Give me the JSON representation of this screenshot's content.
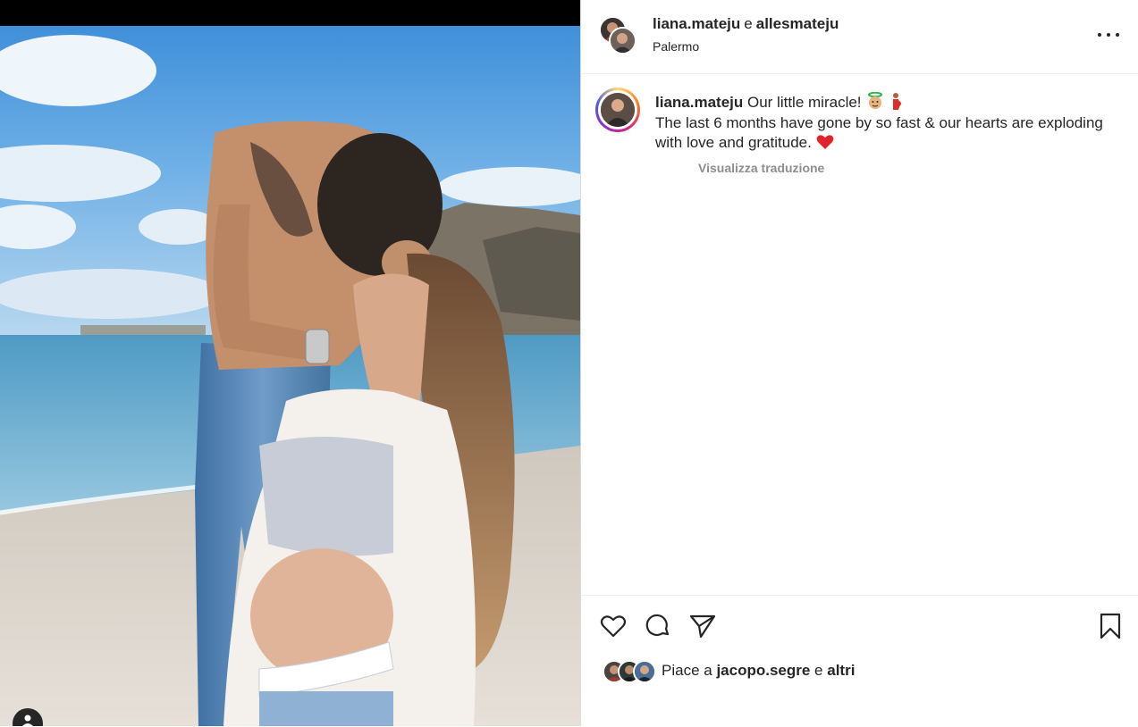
{
  "post": {
    "authors": [
      "liana.mateju",
      "allesmateju"
    ],
    "authors_conjunction": "e",
    "location": "Palermo",
    "more_options_icon": "more-horizontal-icon"
  },
  "caption": {
    "username": "liana.mateju",
    "line1": "Our little miracle!",
    "line2": "The last 6 months have gone by so fast & our hearts are exploding with love and gratitude.",
    "translate_label": "Visualizza traduzione"
  },
  "actions": {
    "like_icon": "heart-icon",
    "comment_icon": "comment-icon",
    "share_icon": "send-icon",
    "save_icon": "bookmark-icon"
  },
  "likes": {
    "prefix": "Piace a",
    "liker": "jacopo.segre",
    "conjunction": "e",
    "others": "altri"
  },
  "colors": {
    "text": "#262626",
    "muted": "#8e8e8e",
    "heart_red": "#e0242c",
    "divider": "#efefef"
  }
}
